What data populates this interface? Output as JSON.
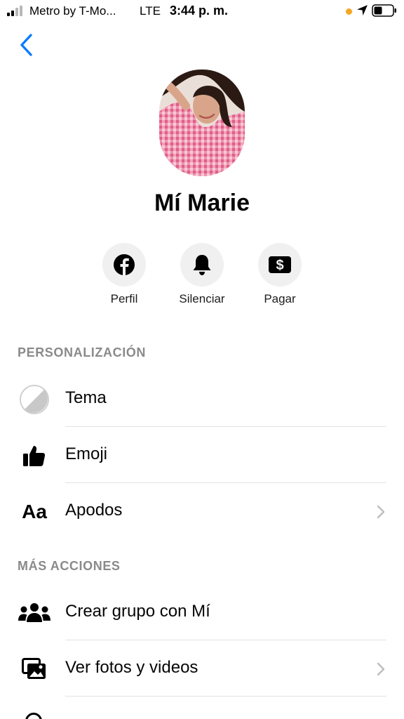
{
  "status_bar": {
    "carrier": "Metro by T-Mo...",
    "network": "LTE",
    "time": "3:44 p. m."
  },
  "profile": {
    "name": "Mí Marie"
  },
  "actions": [
    {
      "label": "Perfil",
      "icon": "facebook-icon"
    },
    {
      "label": "Silenciar",
      "icon": "bell-icon"
    },
    {
      "label": "Pagar",
      "icon": "dollar-icon"
    }
  ],
  "sections": {
    "personalization": {
      "title": "PERSONALIZACIÓN",
      "items": [
        {
          "label": "Tema",
          "icon": "theme-icon"
        },
        {
          "label": "Emoji",
          "icon": "thumbs-up-icon"
        },
        {
          "label": "Apodos",
          "icon": "text-icon",
          "glyph": "Aa"
        }
      ]
    },
    "more_actions": {
      "title": "MÁS ACCIONES",
      "items": [
        {
          "label": "Crear grupo con Mí",
          "icon": "group-icon"
        },
        {
          "label": "Ver fotos y videos",
          "icon": "photos-icon"
        }
      ]
    }
  },
  "colors": {
    "accent": "#0a7cff",
    "location_dot": "#f5a623",
    "icon_bg": "#f0f0f0"
  }
}
